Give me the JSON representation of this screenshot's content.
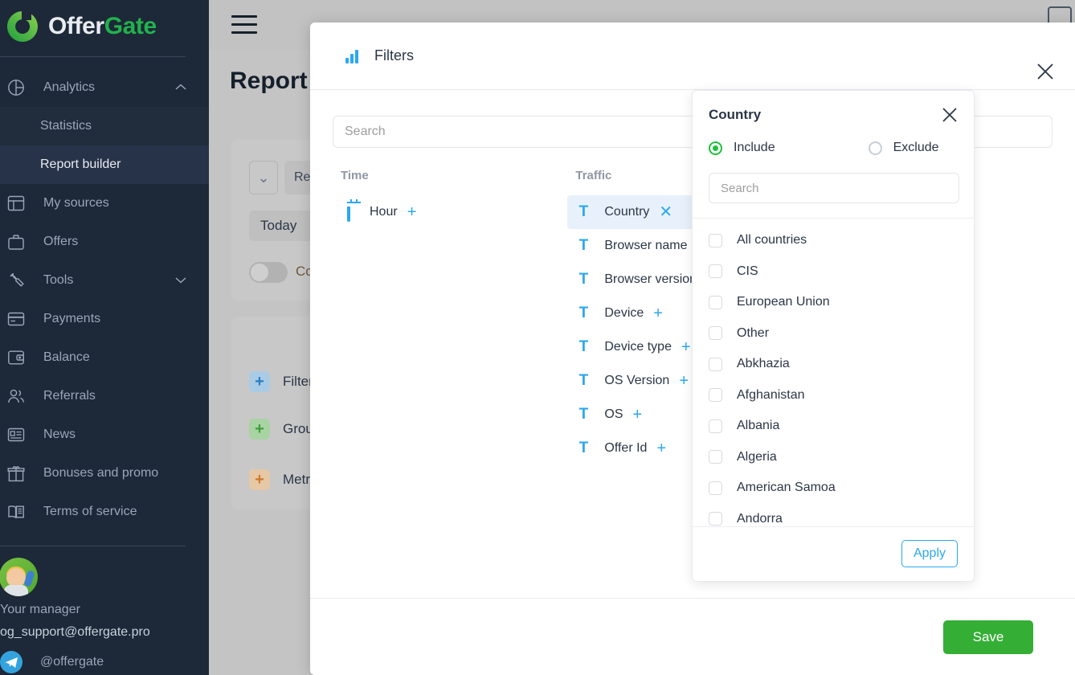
{
  "brand": {
    "part1": "Offer",
    "part2": "Gate"
  },
  "sidebar": {
    "items": [
      {
        "label": "Analytics",
        "icon": "pie-chart-icon",
        "chevron": "⌃"
      },
      {
        "label": "My sources",
        "icon": "window-icon"
      },
      {
        "label": "Offers",
        "icon": "briefcase-icon"
      },
      {
        "label": "Tools",
        "icon": "wrench-icon",
        "chevron": "⌄"
      },
      {
        "label": "Payments",
        "icon": "card-icon"
      },
      {
        "label": "Balance",
        "icon": "wallet-icon"
      },
      {
        "label": "Referrals",
        "icon": "users-icon"
      },
      {
        "label": "News",
        "icon": "news-icon"
      },
      {
        "label": "Bonuses and promo",
        "icon": "gift-icon"
      },
      {
        "label": "Terms of service",
        "icon": "book-icon"
      }
    ],
    "sub_items": [
      {
        "label": "Statistics",
        "active": false
      },
      {
        "label": "Report builder",
        "active": true
      }
    ],
    "manager": {
      "title": "Your manager",
      "email": "og_support@offergate.pro",
      "telegram": "@offergate"
    }
  },
  "page": {
    "title": "Report",
    "select_chevron": "⌄",
    "reset_label": "Re",
    "today_label": "Today",
    "compare_label": "Co",
    "options": [
      {
        "label": "Filter",
        "plus": "+",
        "color": "#a9cbe6",
        "plus_color": "#2b7ec4"
      },
      {
        "label": "Group",
        "plus": "+",
        "color": "#a8d3a2",
        "plus_color": "#3f9e3c"
      },
      {
        "label": "Metri",
        "plus": "+",
        "color": "#e6c8a6",
        "plus_color": "#d0792b"
      }
    ]
  },
  "modal": {
    "title": "Filters",
    "icon": "bar-chart-icon",
    "close_icon": "✕",
    "search_placeholder": "Search",
    "search_value": "",
    "save_label": "Save",
    "columns": [
      {
        "header": "Time",
        "items": [
          {
            "label": "Hour",
            "icon": "calendar-icon",
            "action": "+",
            "selected": false
          }
        ]
      },
      {
        "header": "Traffic",
        "items": [
          {
            "label": "Country",
            "icon": "text-icon",
            "action": "✕",
            "selected": true
          },
          {
            "label": "Browser name",
            "icon": "text-icon",
            "action": "+",
            "selected": false
          },
          {
            "label": "Browser version",
            "icon": "text-icon",
            "action": "+",
            "selected": false
          },
          {
            "label": "Device",
            "icon": "text-icon",
            "action": "+",
            "selected": false
          },
          {
            "label": "Device type",
            "icon": "text-icon",
            "action": "+",
            "selected": false
          },
          {
            "label": "OS Version",
            "icon": "text-icon",
            "action": "+",
            "selected": false
          },
          {
            "label": "OS",
            "icon": "text-icon",
            "action": "+",
            "selected": false
          },
          {
            "label": "Offer Id",
            "icon": "text-icon",
            "action": "+",
            "selected": false
          }
        ]
      }
    ]
  },
  "popover": {
    "title": "Country",
    "close_icon": "✕",
    "include_label": "Include",
    "exclude_label": "Exclude",
    "selected_mode": "Include",
    "search_placeholder": "Search",
    "search_value": "",
    "apply_label": "Apply",
    "options": [
      {
        "label": "All countries",
        "checked": false
      },
      {
        "label": "CIS",
        "checked": false
      },
      {
        "label": "European Union",
        "checked": false
      },
      {
        "label": "Other",
        "checked": false
      },
      {
        "label": "Abkhazia",
        "checked": false
      },
      {
        "label": "Afghanistan",
        "checked": false
      },
      {
        "label": "Albania",
        "checked": false
      },
      {
        "label": "Algeria",
        "checked": false
      },
      {
        "label": "American Samoa",
        "checked": false
      },
      {
        "label": "Andorra",
        "checked": false
      }
    ]
  },
  "colors": {
    "accent_blue": "#2ba8f0",
    "brand_green": "#22b24c",
    "save_green": "#35ae36",
    "sidebar_bg": "#1d2838",
    "sidebar_active": "#273349"
  }
}
